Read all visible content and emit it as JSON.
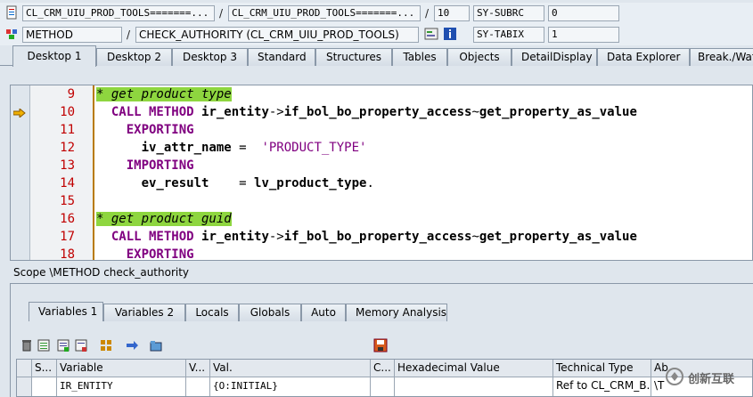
{
  "header": {
    "program_field": "CL_CRM_UIU_PROD_TOOLS=======...",
    "include_field": "CL_CRM_UIU_PROD_TOOLS=======...",
    "line_field": "10",
    "sysfield1_name": "SY-SUBRC",
    "sysfield1_value": "0",
    "event_type": "METHOD",
    "event_name": "CHECK_AUTHORITY (CL_CRM_UIU_PROD_TOOLS)",
    "sysfield2_name": "SY-TABIX",
    "sysfield2_value": "1",
    "slash": "/"
  },
  "desktop_tabs": [
    "Desktop 1",
    "Desktop 2",
    "Desktop 3",
    "Standard",
    "Structures",
    "Tables",
    "Objects",
    "DetailDisplay",
    "Data Explorer",
    "Break./Wat"
  ],
  "source": {
    "current_line": 10,
    "lines": [
      {
        "num": "9",
        "parts": [
          {
            "t": "* get product type",
            "c": "cmt"
          }
        ]
      },
      {
        "num": "10",
        "parts": [
          {
            "t": "  ",
            "c": ""
          },
          {
            "t": "CALL METHOD",
            "c": "kw"
          },
          {
            "t": " ",
            "c": ""
          },
          {
            "t": "ir_entity",
            "c": "id"
          },
          {
            "t": "->",
            "c": ""
          },
          {
            "t": "if_bol_bo_property_access",
            "c": "id"
          },
          {
            "t": "~",
            "c": ""
          },
          {
            "t": "get_property_as_value",
            "c": "id"
          }
        ]
      },
      {
        "num": "11",
        "parts": [
          {
            "t": "    ",
            "c": ""
          },
          {
            "t": "EXPORTING",
            "c": "kw"
          }
        ]
      },
      {
        "num": "12",
        "parts": [
          {
            "t": "      ",
            "c": ""
          },
          {
            "t": "iv_attr_name",
            "c": "id"
          },
          {
            "t": " =  ",
            "c": ""
          },
          {
            "t": "'PRODUCT_TYPE'",
            "c": "str"
          }
        ]
      },
      {
        "num": "13",
        "parts": [
          {
            "t": "    ",
            "c": ""
          },
          {
            "t": "IMPORTING",
            "c": "kw"
          }
        ]
      },
      {
        "num": "14",
        "parts": [
          {
            "t": "      ",
            "c": ""
          },
          {
            "t": "ev_result",
            "c": "id"
          },
          {
            "t": "    = ",
            "c": ""
          },
          {
            "t": "lv_product_type",
            "c": "id"
          },
          {
            "t": ".",
            "c": ""
          }
        ]
      },
      {
        "num": "15",
        "parts": []
      },
      {
        "num": "16",
        "parts": [
          {
            "t": "* get product guid",
            "c": "cmt"
          }
        ]
      },
      {
        "num": "17",
        "parts": [
          {
            "t": "  ",
            "c": ""
          },
          {
            "t": "CALL METHOD",
            "c": "kw"
          },
          {
            "t": " ",
            "c": ""
          },
          {
            "t": "ir_entity",
            "c": "id"
          },
          {
            "t": "->",
            "c": ""
          },
          {
            "t": "if_bol_bo_property_access",
            "c": "id"
          },
          {
            "t": "~",
            "c": ""
          },
          {
            "t": "get_property_as_value",
            "c": "id"
          }
        ]
      },
      {
        "num": "18",
        "parts": [
          {
            "t": "    ",
            "c": ""
          },
          {
            "t": "EXPORTING",
            "c": "kw"
          }
        ]
      }
    ]
  },
  "scope_text": "Scope \\METHOD check_authority",
  "variable_tabs": [
    "Variables 1",
    "Variables 2",
    "Locals",
    "Globals",
    "Auto",
    "Memory Analysis"
  ],
  "grid": {
    "headers": [
      "S...",
      "Variable",
      "V...",
      "Val.",
      "C...",
      "Hexadecimal Value",
      "Technical Type",
      "Ab"
    ],
    "row": [
      "",
      "IR_ENTITY",
      "",
      "{O:INITIAL}",
      "",
      "",
      "Ref to CL_CRM_B...",
      "\\T"
    ]
  },
  "watermark": "创新互联",
  "colors": {
    "comment_bg": "#8ed63f",
    "keyword": "#800080",
    "line_number": "#c00000",
    "bg": "#dfe6ed"
  }
}
